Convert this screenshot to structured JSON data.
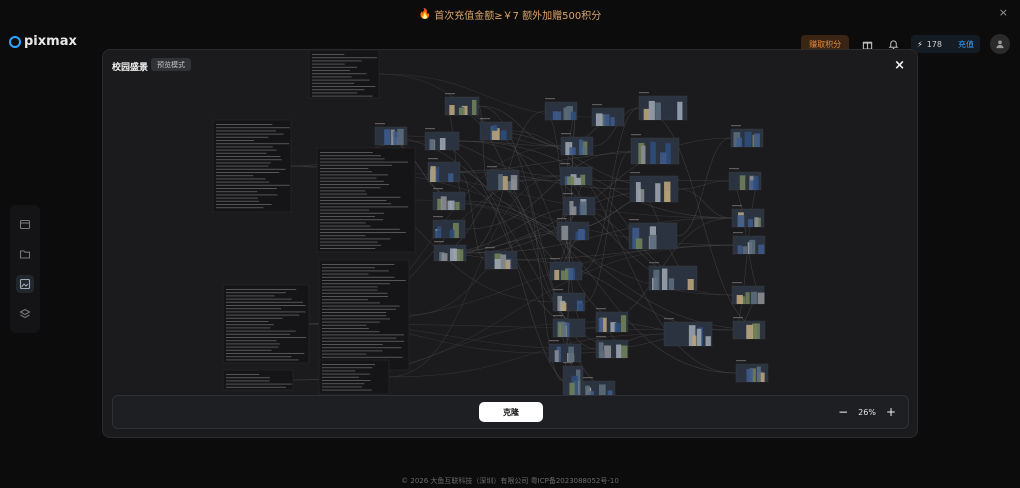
{
  "promo": {
    "text": "首次充值金额≥￥7 额外加赠500积分",
    "fire": "🔥",
    "close": "×"
  },
  "brand": {
    "name": "pixmax"
  },
  "header": {
    "earn_label": "赚取积分",
    "credits": "178",
    "recharge": "充值",
    "bolt": "⚡"
  },
  "footer": {
    "text": "© 2026 大鱼互联科技（深圳）有限公司 粤ICP备2023088052号-10"
  },
  "modal": {
    "title": "校园盛景",
    "badge": "预览模式",
    "close": "×",
    "clone_label": "克隆",
    "zoom_value": "26%",
    "zoom_out": "−",
    "zoom_in": "+"
  },
  "colors": {
    "accent": "#3aa2ff",
    "earn": "#e08a3b",
    "promo": "#d9a36b"
  },
  "icons": [
    "fire-icon",
    "close-icon",
    "pixmax-logo-icon",
    "gift-icon",
    "bell-icon",
    "bolt-icon",
    "user-icon",
    "calendar-icon",
    "folder-icon",
    "image-edit-icon",
    "layers-icon"
  ]
}
